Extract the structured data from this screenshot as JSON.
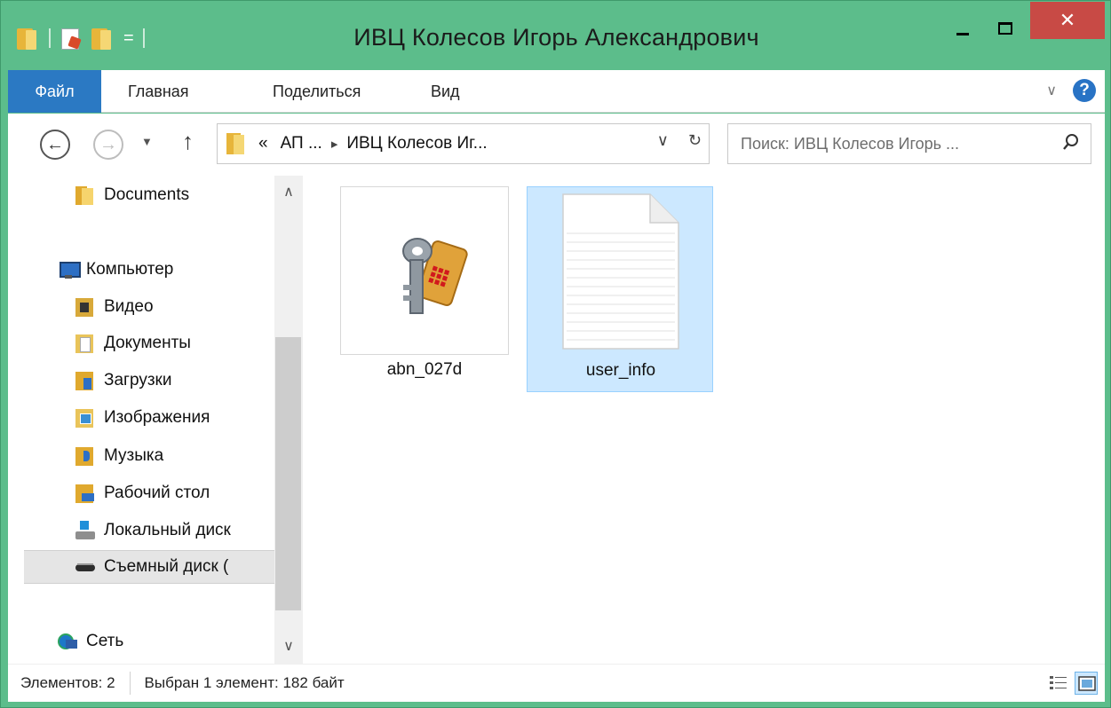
{
  "window": {
    "title": "ИВЦ Колесов Игорь Александрович",
    "close_glyph": "✕"
  },
  "quick_access": {
    "dropdown_glyph": "="
  },
  "ribbon": {
    "tabs": [
      {
        "label": "Файл",
        "active": true
      },
      {
        "label": "Главная"
      },
      {
        "label": "Поделиться"
      },
      {
        "label": "Вид"
      }
    ],
    "expand_glyph": "∨",
    "help_glyph": "?"
  },
  "navigation": {
    "back_glyph": "←",
    "forward_glyph": "→",
    "recent_glyph": "▼",
    "up_glyph": "↑",
    "breadcrumb": {
      "overflow": "«",
      "segments": [
        "АП ...",
        "ИВЦ Колесов Иг..."
      ],
      "separator": "▸"
    },
    "dropdown_glyph": "∨",
    "refresh_glyph": "↻",
    "search_placeholder": "Поиск: ИВЦ Колесов Игорь ..."
  },
  "nav_pane": {
    "items": [
      {
        "label": "Documents",
        "icon": "folder-icon"
      },
      {
        "label": "Компьютер",
        "icon": "computer-icon"
      },
      {
        "label": "Видео",
        "icon": "video-folder-icon"
      },
      {
        "label": "Документы",
        "icon": "documents-folder-icon"
      },
      {
        "label": "Загрузки",
        "icon": "downloads-folder-icon"
      },
      {
        "label": "Изображения",
        "icon": "pictures-folder-icon"
      },
      {
        "label": "Музыка",
        "icon": "music-folder-icon"
      },
      {
        "label": "Рабочий стол",
        "icon": "desktop-folder-icon"
      },
      {
        "label": "Локальный диск",
        "icon": "local-disk-icon"
      },
      {
        "label": "Съемный диск (",
        "icon": "removable-disk-icon",
        "selected": true
      },
      {
        "label": "Сеть",
        "icon": "network-icon"
      }
    ],
    "scroll_up_glyph": "∧",
    "scroll_down_glyph": "∨"
  },
  "files": [
    {
      "name": "abn_027d",
      "icon": "key-certificate-icon",
      "selected": false
    },
    {
      "name": "user_info",
      "icon": "text-document-icon",
      "selected": true
    }
  ],
  "status_bar": {
    "count_text": "Элементов: 2",
    "selection_text": "Выбран 1 элемент: 182 байт"
  },
  "colors": {
    "window_frame": "#5cbd8b",
    "file_tab": "#2b79c3",
    "close_button": "#c84a45",
    "selection": "#cce8ff"
  }
}
